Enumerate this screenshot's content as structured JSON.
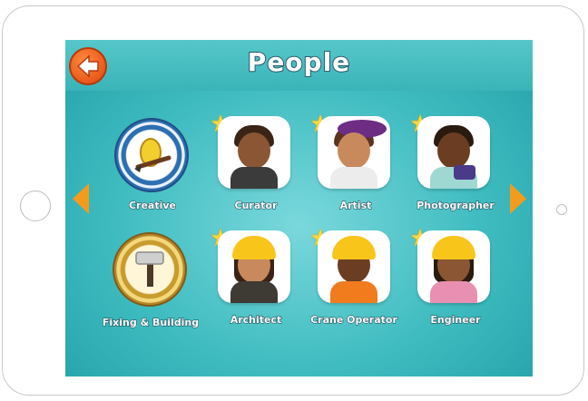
{
  "header": {
    "title": "People"
  },
  "categories": [
    {
      "label": "Creative",
      "icon": "paintbrush-icon"
    },
    {
      "label": "Fixing & Building",
      "icon": "hammer-icon"
    }
  ],
  "people": [
    {
      "label": "Curator",
      "icon": "curator-avatar-icon"
    },
    {
      "label": "Artist",
      "icon": "artist-avatar-icon"
    },
    {
      "label": "Photographer",
      "icon": "photographer-avatar-icon"
    },
    {
      "label": "Architect",
      "icon": "architect-avatar-icon"
    },
    {
      "label": "Crane Operator",
      "icon": "crane-operator-avatar-icon"
    },
    {
      "label": "Engineer",
      "icon": "engineer-avatar-icon"
    }
  ],
  "colors": {
    "accent": "#f39b1c",
    "back_button": "#e0440f",
    "background": "#3fbcc0",
    "star": "#ffd83a"
  }
}
